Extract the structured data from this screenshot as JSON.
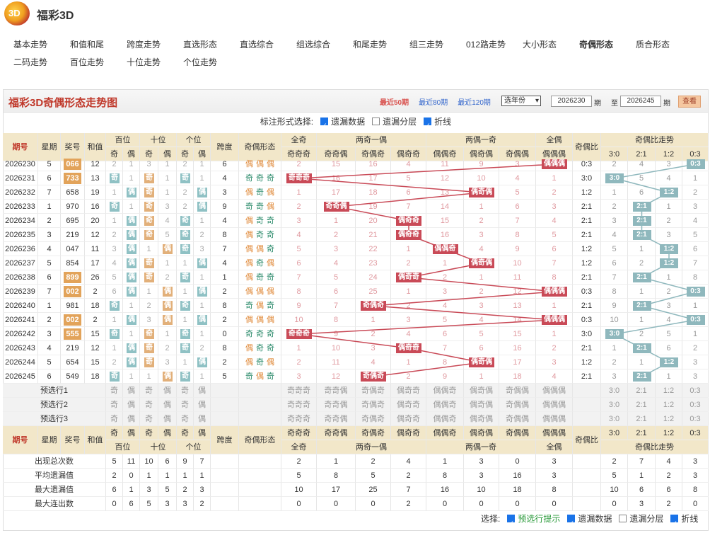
{
  "app": {
    "title": "福彩3D",
    "logo_text": "3D"
  },
  "nav": {
    "row1": [
      "基本走势",
      "和值和尾",
      "跨度走势",
      "直选形态",
      "直选综合",
      "组选综合",
      "和尾走势",
      "组三走势",
      "012路走势",
      "大小形态",
      "奇偶形态",
      "质合形态"
    ],
    "row2": [
      "二码走势",
      "百位走势",
      "十位走势",
      "个位走势"
    ],
    "active": "奇偶形态"
  },
  "panel": {
    "title": "福彩3D奇偶形态走势图",
    "links": [
      "最近50期",
      "最近80期",
      "最近120期"
    ],
    "year_select": "选年份",
    "from_issue": "2026230",
    "issue_label": "期",
    "to_label": "至",
    "to_issue": "2026245",
    "view_button": "查看"
  },
  "options": {
    "label": "标注形式选择:",
    "items": [
      {
        "label": "遗漏数据",
        "checked": true
      },
      {
        "label": "遗漏分层",
        "checked": false
      },
      {
        "label": "折线",
        "checked": true
      }
    ]
  },
  "headers": {
    "issue": "期号",
    "weekday": "星期",
    "prize": "奖号",
    "sum": "和值",
    "bai": "百位",
    "shi": "十位",
    "ge": "个位",
    "odd": "奇",
    "even": "偶",
    "span": "跨度",
    "form": "奇偶形态",
    "g_all_odd": "全奇",
    "g_two_odd": "两奇一偶",
    "g_two_even": "两偶一奇",
    "g_all_even": "全偶",
    "ratio": "奇偶比",
    "ratio_trend": "奇偶比走势"
  },
  "patterns": [
    "奇奇奇",
    "奇奇偶",
    "奇偶奇",
    "偶奇奇",
    "偶偶奇",
    "偶奇偶",
    "奇偶偶",
    "偶偶偶"
  ],
  "ratios": [
    "3:0",
    "2:1",
    "1:2",
    "0:3"
  ],
  "rows": [
    {
      "issue": "2026230",
      "wd": "5",
      "num": "066",
      "sum": "12",
      "span": "6",
      "hl": true,
      "form": [
        "偶",
        "偶",
        "偶"
      ],
      "pos": [
        2,
        1,
        3,
        1,
        2,
        1
      ],
      "pat": [
        2,
        15,
        16,
        4,
        11,
        9,
        3,
        "偶偶偶"
      ],
      "pat_hit": 7,
      "ratio": "0:3",
      "rt": [
        2,
        4,
        3,
        "0:3"
      ],
      "rt_hit": 3
    },
    {
      "issue": "2026231",
      "wd": "6",
      "num": "733",
      "sum": "13",
      "span": "4",
      "hl": true,
      "form": [
        "奇",
        "奇",
        "奇"
      ],
      "pos": [
        "奇",
        1,
        "奇",
        1,
        "奇",
        1
      ],
      "pat": [
        "奇奇奇",
        16,
        17,
        5,
        12,
        10,
        4,
        1
      ],
      "pat_hit": 0,
      "ratio": "3:0",
      "rt": [
        "3:0",
        5,
        4,
        1
      ],
      "rt_hit": 0
    },
    {
      "issue": "2026232",
      "wd": "7",
      "num": "658",
      "sum": "19",
      "span": "3",
      "hl": false,
      "form": [
        "偶",
        "奇",
        "偶"
      ],
      "pos": [
        1,
        "偶",
        "奇",
        1,
        2,
        "偶"
      ],
      "pat": [
        1,
        17,
        18,
        6,
        13,
        "偶奇偶",
        5,
        2
      ],
      "pat_hit": 5,
      "ratio": "1:2",
      "rt": [
        1,
        6,
        "1:2",
        2
      ],
      "rt_hit": 2
    },
    {
      "issue": "2026233",
      "wd": "1",
      "num": "970",
      "sum": "16",
      "span": "9",
      "hl": false,
      "form": [
        "奇",
        "奇",
        "偶"
      ],
      "pos": [
        "奇",
        1,
        "奇",
        3,
        2,
        "偶"
      ],
      "pat": [
        2,
        "奇奇偶",
        19,
        7,
        14,
        1,
        6,
        3
      ],
      "pat_hit": 1,
      "ratio": "2:1",
      "rt": [
        2,
        "2:1",
        1,
        3
      ],
      "rt_hit": 1
    },
    {
      "issue": "2026234",
      "wd": "2",
      "num": "695",
      "sum": "20",
      "span": "4",
      "hl": false,
      "form": [
        "偶",
        "奇",
        "奇"
      ],
      "pos": [
        1,
        "偶",
        "奇",
        4,
        "奇",
        1
      ],
      "pat": [
        3,
        1,
        20,
        "偶奇奇",
        15,
        2,
        7,
        4
      ],
      "pat_hit": 3,
      "ratio": "2:1",
      "rt": [
        3,
        "2:1",
        2,
        4
      ],
      "rt_hit": 1
    },
    {
      "issue": "2026235",
      "wd": "3",
      "num": "219",
      "sum": "12",
      "span": "8",
      "hl": false,
      "form": [
        "偶",
        "奇",
        "奇"
      ],
      "pos": [
        2,
        "偶",
        "奇",
        5,
        "奇",
        2
      ],
      "pat": [
        4,
        2,
        21,
        "偶奇奇",
        16,
        3,
        8,
        5
      ],
      "pat_hit": 3,
      "ratio": "2:1",
      "rt": [
        4,
        "2:1",
        3,
        5
      ],
      "rt_hit": 1
    },
    {
      "issue": "2026236",
      "wd": "4",
      "num": "047",
      "sum": "11",
      "span": "7",
      "hl": false,
      "form": [
        "偶",
        "偶",
        "奇"
      ],
      "pos": [
        3,
        "偶",
        1,
        "偶",
        "奇",
        3
      ],
      "pat": [
        5,
        3,
        22,
        1,
        "偶偶奇",
        4,
        9,
        6
      ],
      "pat_hit": 4,
      "ratio": "1:2",
      "rt": [
        5,
        1,
        "1:2",
        6
      ],
      "rt_hit": 2
    },
    {
      "issue": "2026237",
      "wd": "5",
      "num": "854",
      "sum": "17",
      "span": "4",
      "hl": false,
      "form": [
        "偶",
        "奇",
        "偶"
      ],
      "pos": [
        4,
        "偶",
        "奇",
        1,
        1,
        "偶"
      ],
      "pat": [
        6,
        4,
        23,
        2,
        1,
        "偶奇偶",
        10,
        7
      ],
      "pat_hit": 5,
      "ratio": "1:2",
      "rt": [
        6,
        2,
        "1:2",
        7
      ],
      "rt_hit": 2
    },
    {
      "issue": "2026238",
      "wd": "6",
      "num": "899",
      "sum": "26",
      "span": "1",
      "hl": true,
      "form": [
        "偶",
        "奇",
        "奇"
      ],
      "pos": [
        5,
        "偶",
        "奇",
        2,
        "奇",
        1
      ],
      "pat": [
        7,
        5,
        24,
        "偶奇奇",
        2,
        1,
        11,
        8
      ],
      "pat_hit": 3,
      "ratio": "2:1",
      "rt": [
        7,
        "2:1",
        1,
        8
      ],
      "rt_hit": 1
    },
    {
      "issue": "2026239",
      "wd": "7",
      "num": "002",
      "sum": "2",
      "span": "2",
      "hl": true,
      "form": [
        "偶",
        "偶",
        "偶"
      ],
      "pos": [
        6,
        "偶",
        1,
        "偶",
        1,
        "偶"
      ],
      "pat": [
        8,
        6,
        25,
        1,
        3,
        2,
        12,
        "偶偶偶"
      ],
      "pat_hit": 7,
      "ratio": "0:3",
      "rt": [
        8,
        1,
        2,
        "0:3"
      ],
      "rt_hit": 3
    },
    {
      "issue": "2026240",
      "wd": "1",
      "num": "981",
      "sum": "18",
      "span": "8",
      "hl": false,
      "form": [
        "奇",
        "偶",
        "奇"
      ],
      "pos": [
        "奇",
        1,
        2,
        "偶",
        "奇",
        1
      ],
      "pat": [
        9,
        7,
        "奇偶奇",
        2,
        4,
        3,
        13,
        1
      ],
      "pat_hit": 2,
      "ratio": "2:1",
      "rt": [
        9,
        "2:1",
        3,
        1
      ],
      "rt_hit": 1
    },
    {
      "issue": "2026241",
      "wd": "2",
      "num": "002",
      "sum": "2",
      "span": "2",
      "hl": true,
      "form": [
        "偶",
        "偶",
        "偶"
      ],
      "pos": [
        1,
        "偶",
        3,
        "偶",
        1,
        "偶"
      ],
      "pat": [
        10,
        8,
        1,
        3,
        5,
        4,
        14,
        "偶偶偶"
      ],
      "pat_hit": 7,
      "ratio": "0:3",
      "rt": [
        10,
        1,
        4,
        "0:3"
      ],
      "rt_hit": 3
    },
    {
      "issue": "2026242",
      "wd": "3",
      "num": "555",
      "sum": "15",
      "span": "0",
      "hl": true,
      "form": [
        "奇",
        "奇",
        "奇"
      ],
      "pos": [
        "奇",
        1,
        "奇",
        1,
        "奇",
        1
      ],
      "pat": [
        "奇奇奇",
        9,
        2,
        4,
        6,
        5,
        15,
        1
      ],
      "pat_hit": 0,
      "ratio": "3:0",
      "rt": [
        "3:0",
        2,
        5,
        1
      ],
      "rt_hit": 0
    },
    {
      "issue": "2026243",
      "wd": "4",
      "num": "219",
      "sum": "12",
      "span": "8",
      "hl": false,
      "form": [
        "偶",
        "奇",
        "奇"
      ],
      "pos": [
        1,
        "偶",
        "奇",
        2,
        "奇",
        2
      ],
      "pat": [
        1,
        10,
        3,
        "偶奇奇",
        7,
        6,
        16,
        2
      ],
      "pat_hit": 3,
      "ratio": "2:1",
      "rt": [
        1,
        "2:1",
        6,
        2
      ],
      "rt_hit": 1
    },
    {
      "issue": "2026244",
      "wd": "5",
      "num": "654",
      "sum": "15",
      "span": "2",
      "hl": false,
      "form": [
        "偶",
        "奇",
        "偶"
      ],
      "pos": [
        2,
        "偶",
        "奇",
        3,
        1,
        "偶"
      ],
      "pat": [
        2,
        11,
        4,
        1,
        8,
        "偶奇偶",
        17,
        3
      ],
      "pat_hit": 5,
      "ratio": "1:2",
      "rt": [
        2,
        1,
        "1:2",
        3
      ],
      "rt_hit": 2
    },
    {
      "issue": "2026245",
      "wd": "6",
      "num": "549",
      "sum": "18",
      "span": "5",
      "hl": false,
      "form": [
        "奇",
        "偶",
        "奇"
      ],
      "pos": [
        "奇",
        1,
        1,
        "偶",
        "奇",
        1
      ],
      "pat": [
        3,
        12,
        "奇偶奇",
        2,
        9,
        1,
        18,
        4
      ],
      "pat_hit": 2,
      "ratio": "2:1",
      "rt": [
        3,
        "2:1",
        1,
        3
      ],
      "rt_hit": 1
    }
  ],
  "presel": [
    "预选行1",
    "预选行2",
    "预选行3"
  ],
  "stats": [
    {
      "label": "出现总次数",
      "pos": [
        5,
        11,
        10,
        6,
        9,
        7
      ],
      "pat": [
        2,
        1,
        2,
        4,
        1,
        3,
        0,
        3
      ],
      "rt": [
        2,
        7,
        4,
        3
      ]
    },
    {
      "label": "平均遗漏值",
      "pos": [
        2,
        0,
        1,
        1,
        1,
        1
      ],
      "pat": [
        5,
        8,
        5,
        2,
        8,
        3,
        16,
        3
      ],
      "rt": [
        5,
        1,
        2,
        3
      ]
    },
    {
      "label": "最大遗漏值",
      "pos": [
        6,
        1,
        3,
        5,
        2,
        3
      ],
      "pat": [
        10,
        17,
        25,
        7,
        16,
        10,
        18,
        8
      ],
      "rt": [
        10,
        6,
        6,
        8
      ]
    },
    {
      "label": "最大连出数",
      "pos": [
        0,
        6,
        5,
        3,
        3,
        2
      ],
      "pat": [
        0,
        0,
        0,
        2,
        0,
        0,
        0,
        0
      ],
      "rt": [
        0,
        3,
        2,
        0
      ]
    }
  ],
  "footer": {
    "label": "选择:",
    "items": [
      {
        "label": "预选行提示",
        "checked": true
      },
      {
        "label": "遗漏数据",
        "checked": true
      },
      {
        "label": "遗漏分层",
        "checked": false
      },
      {
        "label": "折线",
        "checked": true
      }
    ]
  },
  "colors": {
    "hit": "#c94a57",
    "bai_odd": "#e2b07a",
    "shi_even": "#8fc1c4",
    "ratio_hit": "#8fb8bd",
    "header_bg": "#f2e7c9",
    "missing_text": "#e09aa0"
  }
}
